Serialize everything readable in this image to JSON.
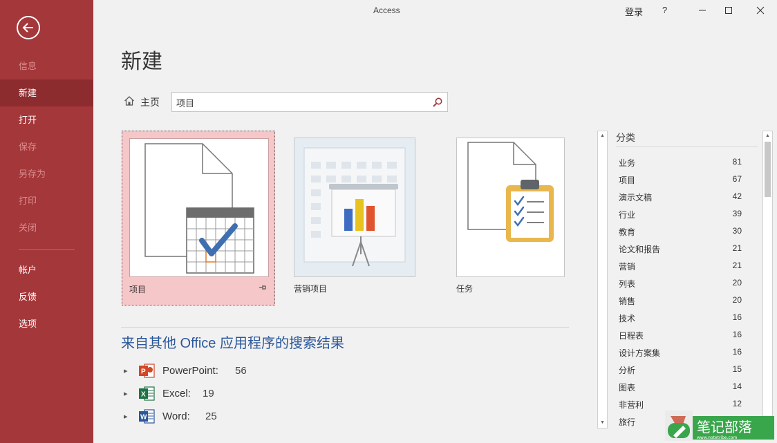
{
  "window": {
    "title": "Access",
    "signin": "登录",
    "help": "?"
  },
  "sidebar": {
    "items": [
      {
        "label": "信息",
        "state": "disabled"
      },
      {
        "label": "新建",
        "state": "active"
      },
      {
        "label": "打开",
        "state": "normal"
      },
      {
        "label": "保存",
        "state": "disabled"
      },
      {
        "label": "另存为",
        "state": "disabled"
      },
      {
        "label": "打印",
        "state": "disabled"
      },
      {
        "label": "关闭",
        "state": "disabled"
      },
      {
        "label": "帐户",
        "state": "normal"
      },
      {
        "label": "反馈",
        "state": "normal"
      },
      {
        "label": "选项",
        "state": "normal"
      }
    ]
  },
  "main": {
    "title": "新建",
    "home_label": "主页",
    "search_value": "项目",
    "templates": [
      {
        "label": "项目"
      },
      {
        "label": "营销项目"
      },
      {
        "label": "任务"
      }
    ],
    "other_title": "来自其他 Office 应用程序的搜索结果",
    "results": [
      {
        "app": "PowerPoint:",
        "count": "56",
        "icon": "powerpoint-icon"
      },
      {
        "app": "Excel:",
        "count": "19",
        "icon": "excel-icon"
      },
      {
        "app": "Word:",
        "count": "25",
        "icon": "word-icon"
      }
    ]
  },
  "categories": {
    "header": "分类",
    "items": [
      {
        "name": "业务",
        "count": "81"
      },
      {
        "name": "项目",
        "count": "67"
      },
      {
        "name": "演示文稿",
        "count": "42"
      },
      {
        "name": "行业",
        "count": "39"
      },
      {
        "name": "教育",
        "count": "30"
      },
      {
        "name": "论文和报告",
        "count": "21"
      },
      {
        "name": "营销",
        "count": "21"
      },
      {
        "name": "列表",
        "count": "20"
      },
      {
        "name": "销售",
        "count": "20"
      },
      {
        "name": "技术",
        "count": "16"
      },
      {
        "name": "日程表",
        "count": "16"
      },
      {
        "name": "设计方案集",
        "count": "16"
      },
      {
        "name": "分析",
        "count": "15"
      },
      {
        "name": "图表",
        "count": "14"
      },
      {
        "name": "非营利",
        "count": "12"
      },
      {
        "name": "旅行",
        "count": ""
      }
    ]
  },
  "watermark": {
    "text": "笔记部落",
    "url": "www.notetribe.com"
  },
  "colors": {
    "sidebar": "#a4373a",
    "sidebar_active": "#8c2c2f",
    "accent_blue": "#2b579a",
    "selected_tile": "#f6c7c9"
  }
}
